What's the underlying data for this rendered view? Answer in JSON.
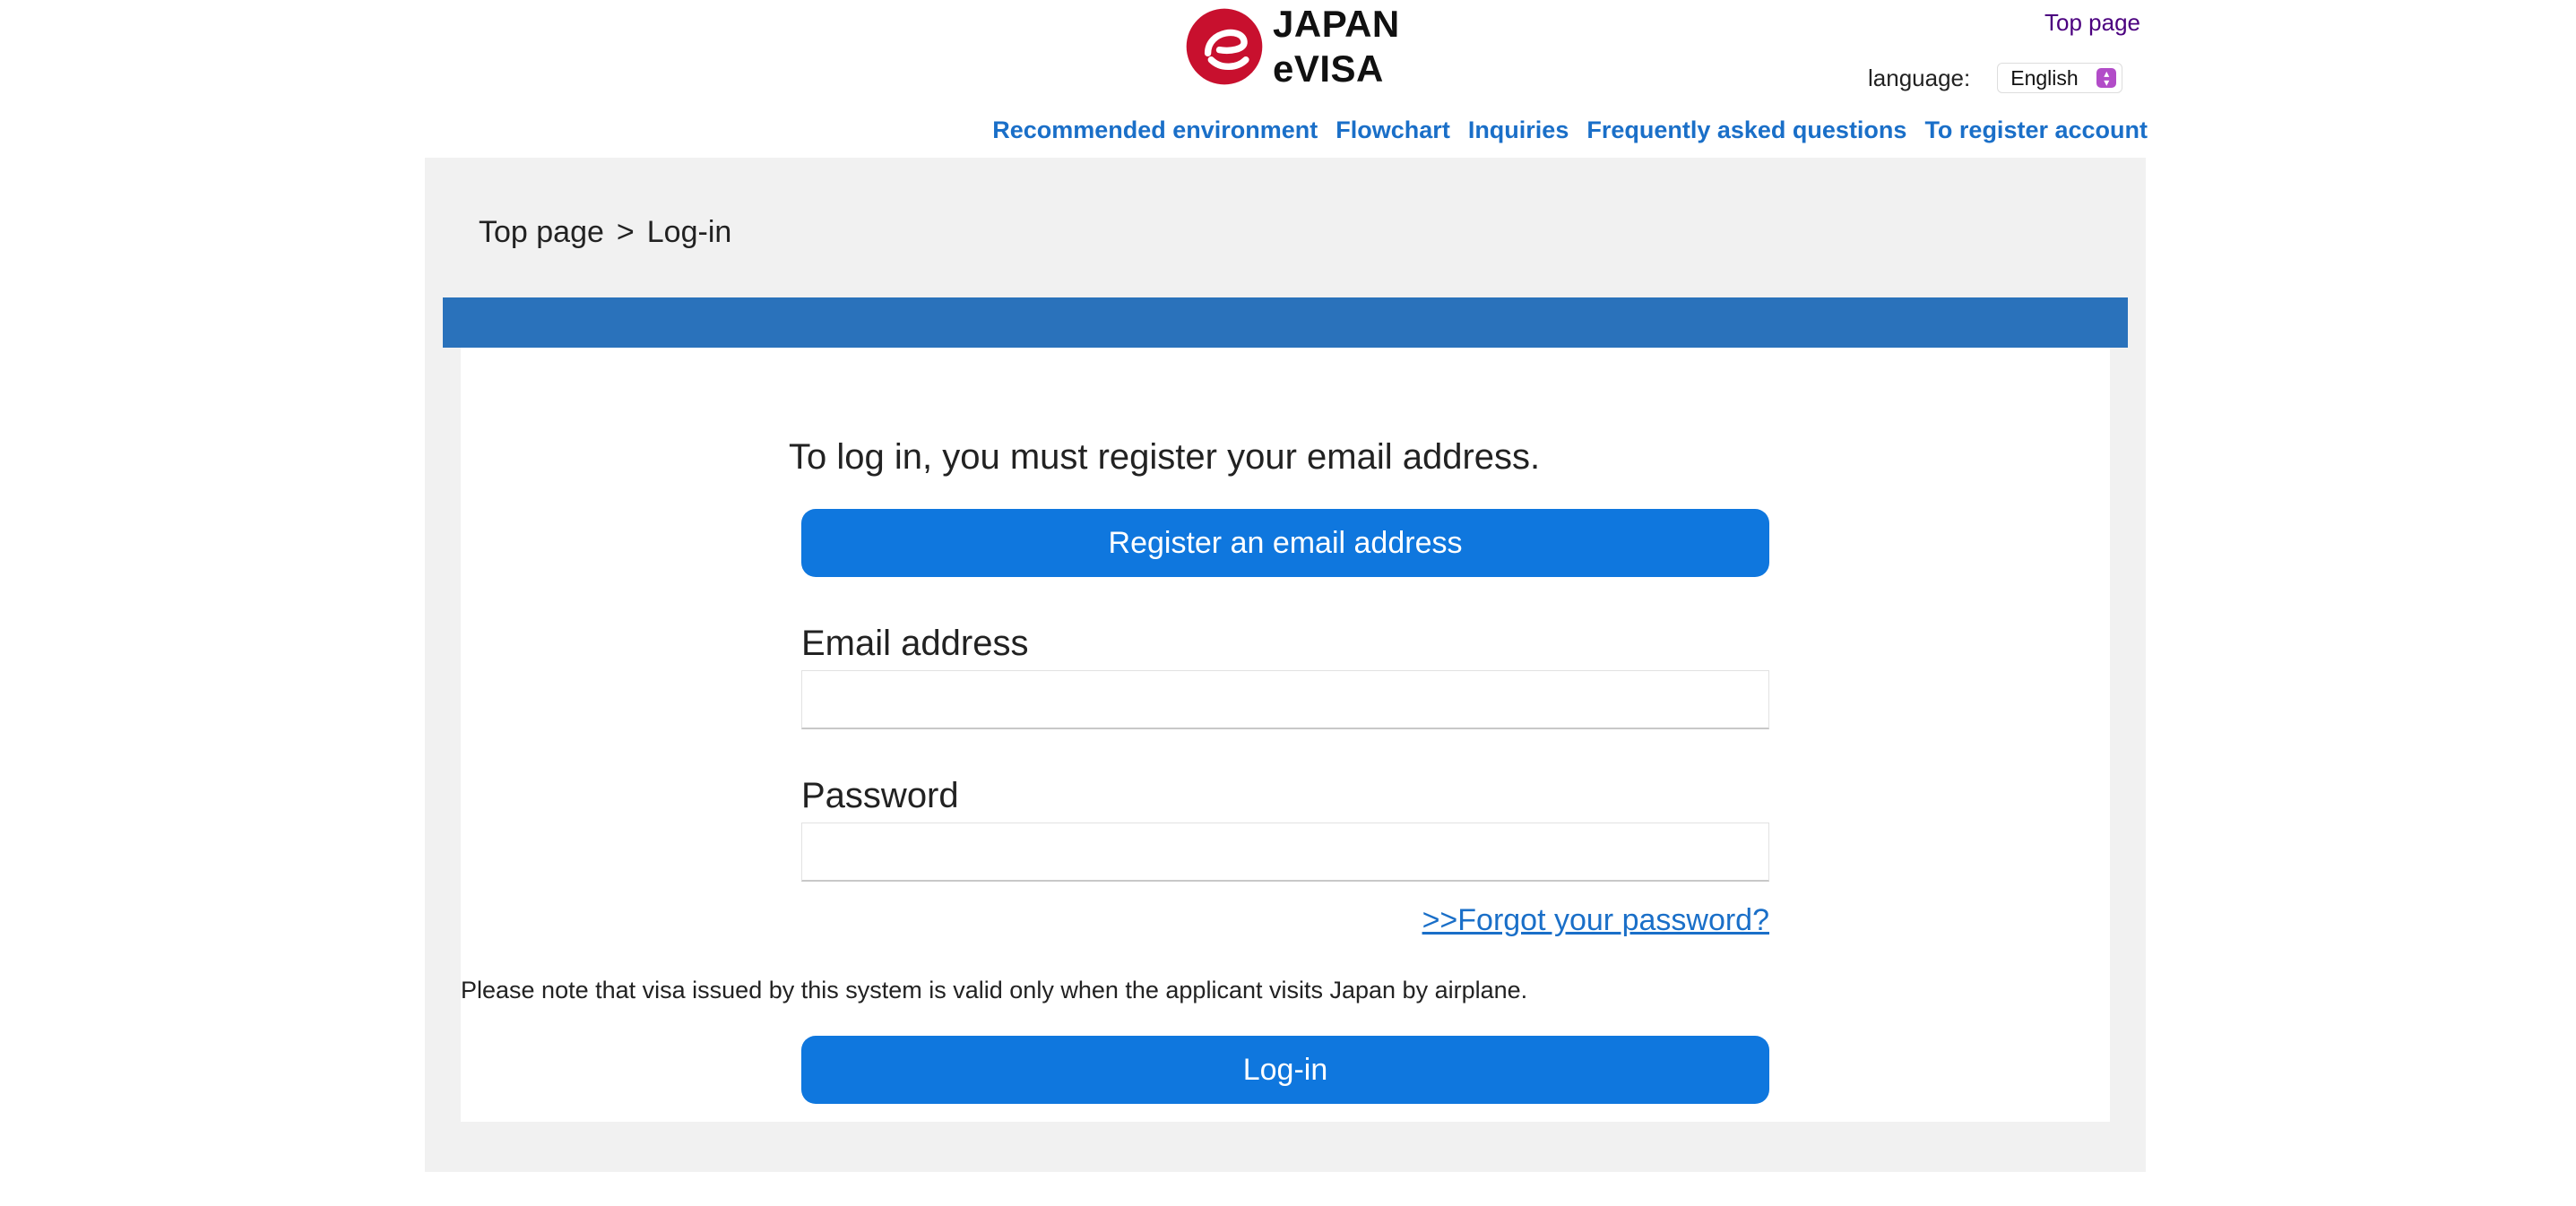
{
  "header": {
    "logo_line1": "JAPAN",
    "logo_line2": "eVISA",
    "top_page_link": "Top page",
    "language_label": "language:",
    "language_value": "English"
  },
  "nav": {
    "items": [
      "Recommended environment",
      "Flowchart",
      "Inquiries",
      "Frequently asked questions",
      "To register account"
    ]
  },
  "breadcrumb": {
    "home": "Top page",
    "separator": ">",
    "current": "Log-in"
  },
  "login": {
    "intro": "To log in, you must register your email address.",
    "register_button": "Register an email address",
    "email_label": "Email address",
    "email_value": "",
    "password_label": "Password",
    "password_value": "",
    "forgot_link": ">>Forgot your password?",
    "note": "Please note that visa issued by this system is valid only when the applicant visits Japan by airplane.",
    "login_button": "Log-in"
  },
  "colors": {
    "accent": "#0f77de",
    "bar": "#2a72bb",
    "link": "#1a6fc8",
    "logo_red": "#c8102e",
    "panel_bg": "#f1f1f1"
  }
}
